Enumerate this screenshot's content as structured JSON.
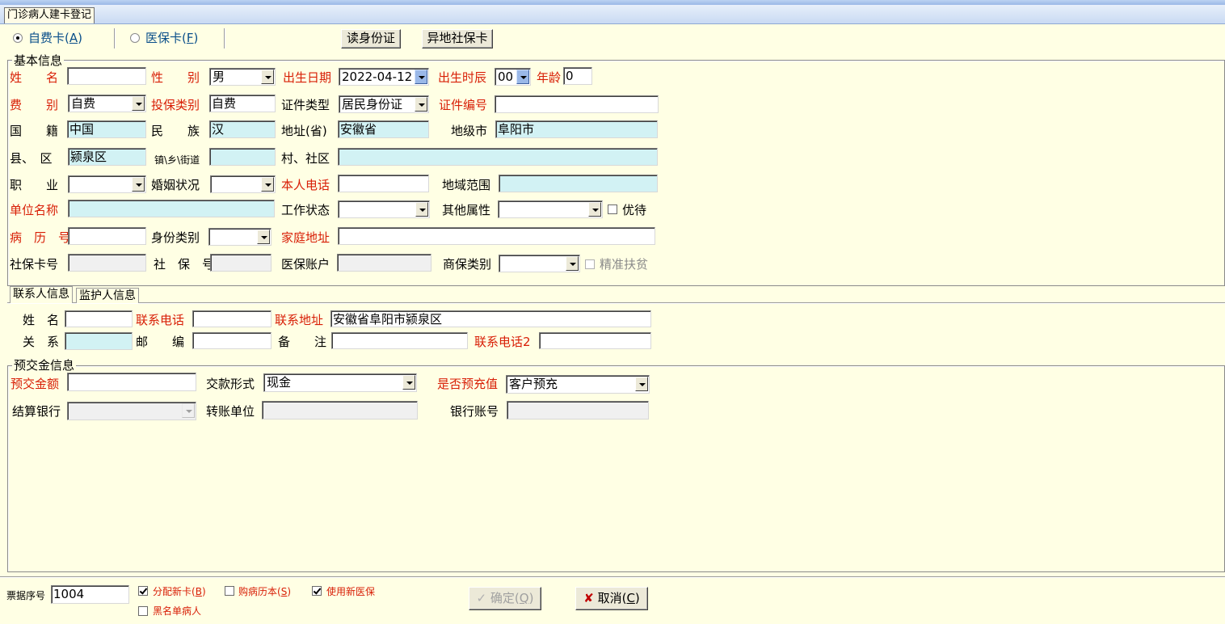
{
  "window": {
    "tab_title": "门诊病人建卡登记"
  },
  "card_type": {
    "self_pay_label": "自费卡",
    "self_pay_key": "A",
    "insurance_label": "医保卡",
    "insurance_key": "F",
    "read_id_button": "读身份证",
    "remote_card_button": "异地社保卡"
  },
  "basic": {
    "group_title": "基本信息",
    "name_label": "姓　　名",
    "name_value": "",
    "sex_label": "性　　别",
    "sex_value": "男",
    "birth_date_label": "出生日期",
    "birth_date_value": "2022-04-12",
    "birth_hour_label": "出生时辰",
    "birth_hour_value": "00",
    "age_label": "年龄",
    "age_value": "0",
    "fee_type_label": "费　　别",
    "fee_type_value": "自费",
    "insured_type_label": "投保类别",
    "insured_type_value": "自费",
    "id_type_label": "证件类型",
    "id_type_value": "居民身份证",
    "id_number_label": "证件编号",
    "id_number_value": "",
    "nationality_label": "国　　籍",
    "nationality_value": "中国",
    "ethnicity_label": "民　　族",
    "ethnicity_value": "汉",
    "province_label": "地址(省)",
    "province_value": "安徽省",
    "city_label": "地级市",
    "city_value": "阜阳市",
    "county_label": "县、　区",
    "county_value": "颍泉区",
    "town_label": "镇\\乡\\街道",
    "town_value": "",
    "village_label": "村、社区",
    "village_value": "",
    "occupation_label": "职　　业",
    "occupation_value": "",
    "marital_label": "婚姻状况",
    "marital_value": "",
    "phone_label": "本人电话",
    "phone_value": "",
    "region_label": "地域范围",
    "region_value": "",
    "employer_label": "单位名称",
    "employer_value": "",
    "work_status_label": "工作状态",
    "work_status_value": "",
    "other_attr_label": "其他属性",
    "other_attr_value": "",
    "preferential_label": "优待",
    "record_no_label": "病　历　号",
    "record_no_value": "",
    "identity_label": "身份类别",
    "identity_value": "",
    "home_addr_label": "家庭地址",
    "home_addr_value": "",
    "si_card_label": "社保卡号",
    "si_card_value": "",
    "si_no_label": "社　保　号",
    "si_no_value": "",
    "mi_account_label": "医保账户",
    "mi_account_value": "",
    "commercial_label": "商保类别",
    "commercial_value": "",
    "poverty_label": "精准扶贫"
  },
  "contact_tabs": [
    "联系人信息",
    "监护人信息"
  ],
  "contact": {
    "name_label": "姓　名",
    "name_value": "",
    "phone_label": "联系电话",
    "phone_value": "",
    "addr_label": "联系地址",
    "addr_value": "安徽省阜阳市颍泉区",
    "relation_label": "关　系",
    "relation_value": "",
    "zip_label": "邮　　编",
    "zip_value": "",
    "note_label": "备　　注",
    "note_value": "",
    "phone2_label": "联系电话2",
    "phone2_value": ""
  },
  "prepay": {
    "group_title": "预交金信息",
    "amount_label": "预交金额",
    "amount_value": "",
    "method_label": "交款形式",
    "method_value": "现金",
    "prerecharge_label": "是否预充值",
    "prerecharge_value": "客户预充",
    "bank_label": "结算银行",
    "bank_value": "",
    "transfer_label": "转账单位",
    "transfer_value": "",
    "account_label": "银行账号",
    "account_value": ""
  },
  "footer": {
    "ticket_label": "票据序号",
    "ticket_value": "1004",
    "assign_card_label": "分配新卡",
    "assign_card_key": "B",
    "assign_card_checked": true,
    "buy_record_label": "购病历本",
    "buy_record_key": "S",
    "buy_record_checked": false,
    "new_mi_label": "使用新医保",
    "new_mi_checked": true,
    "blacklist_label": "黑名单病人",
    "blacklist_checked": false,
    "confirm_label": "确定",
    "confirm_key": "Q",
    "cancel_label": "取消",
    "cancel_key": "C"
  },
  "colors": {
    "background": "#ffffe4",
    "required_label": "#d81e06",
    "highlight_field": "#d2f2f4"
  }
}
